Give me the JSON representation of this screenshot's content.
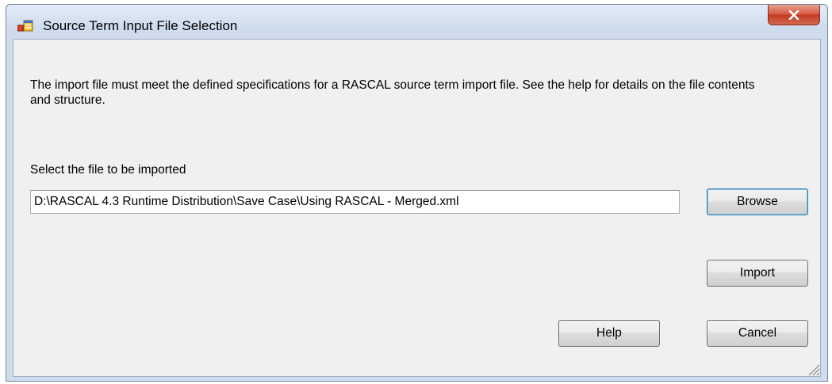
{
  "window": {
    "title": "Source Term Input File Selection",
    "close_glyph": "X",
    "app_icon": "dialog-app-icon"
  },
  "dialog": {
    "description": "The import file must meet the defined specifications for a RASCAL source term import file. See the help for details on the file contents and structure.",
    "select_label": "Select the file to be imported",
    "file_path": "D:\\RASCAL 4.3 Runtime Distribution\\Save Case\\Using RASCAL - Merged.xml"
  },
  "buttons": {
    "browse": "Browse",
    "import": "Import",
    "help": "Help",
    "cancel": "Cancel"
  },
  "colors": {
    "close_button": "#c94a32",
    "client_background": "#f0f0f0",
    "frame": "#cfdced"
  }
}
